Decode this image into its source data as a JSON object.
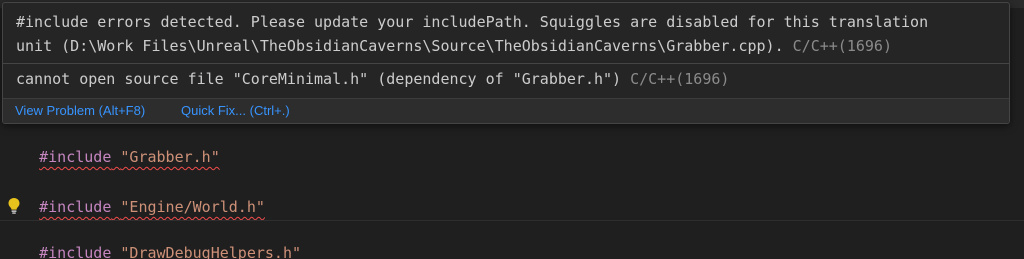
{
  "hover": {
    "problem1": {
      "line1": "#include errors detected. Please update your includePath. Squiggles are disabled for this translation",
      "line2_text": "unit (D:\\Work Files\\Unreal\\TheObsidianCaverns\\Source\\TheObsidianCaverns\\Grabber.cpp).",
      "code": "C/C++(1696)"
    },
    "problem2": {
      "text": "cannot open source file \"CoreMinimal.h\" (dependency of \"Grabber.h\")",
      "code": "C/C++(1696)"
    },
    "actions": {
      "view_problem": "View Problem (Alt+F8)",
      "quick_fix": "Quick Fix... (Ctrl+.)"
    }
  },
  "editor": {
    "lines": [
      {
        "directive": "#include",
        "path": "\"Grabber.h\""
      },
      {
        "directive": "#include",
        "path": "\"Engine/World.h\""
      },
      {
        "directive": "#include",
        "path": "\"DrawDebugHelpers.h\""
      }
    ]
  },
  "colors": {
    "background": "#1f1f1f",
    "hover_background": "#252526",
    "directive": "#c586c0",
    "string": "#ce9178",
    "squiggle": "#f14c4c",
    "link": "#3794ff",
    "error_code": "#8b8b8b"
  },
  "icons": {
    "lightbulb": "lightbulb-icon"
  }
}
